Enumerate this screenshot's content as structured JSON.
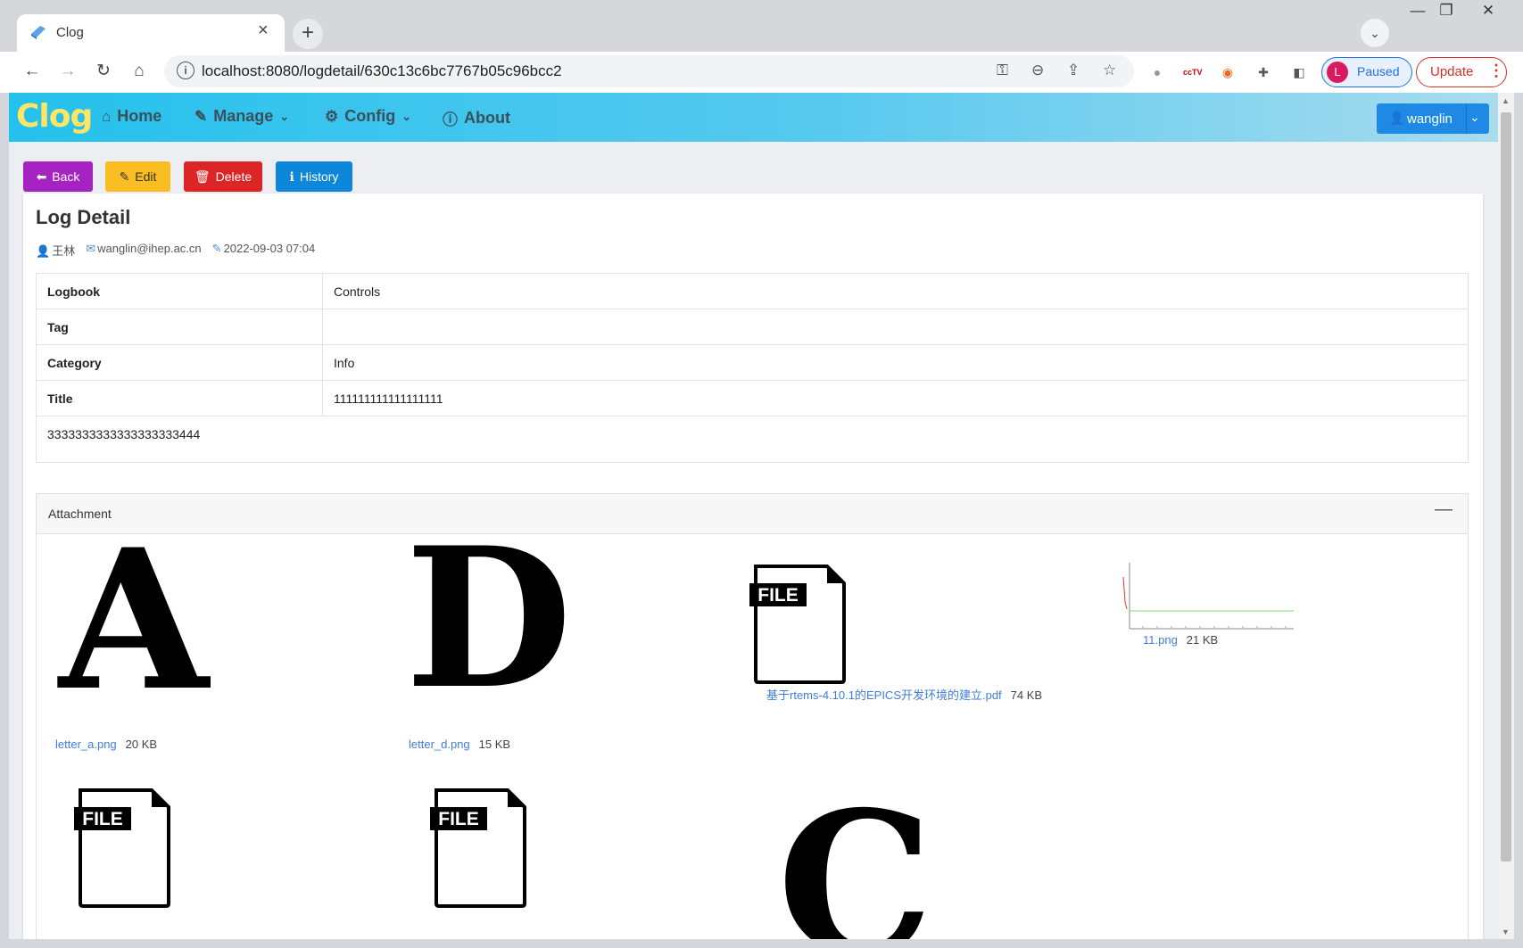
{
  "browser": {
    "tab_title": "Clog",
    "url": "localhost:8080/logdetail/630c13c6bc7767b05c96bcc2",
    "profile_initial": "L",
    "profile_label": "Paused",
    "update_label": "Update"
  },
  "app": {
    "brand": "Clog",
    "nav": {
      "home": "Home",
      "manage": "Manage",
      "config": "Config",
      "about": "About"
    },
    "user": "wanglin"
  },
  "actions": {
    "back": "Back",
    "edit": "Edit",
    "delete": "Delete",
    "history": "History"
  },
  "detail": {
    "title": "Log Detail",
    "author": "王林",
    "email": "wanglin@ihep.ac.cn",
    "date": "2022-09-03 07:04",
    "rows": [
      {
        "key": "Logbook",
        "value": "Controls"
      },
      {
        "key": "Tag",
        "value": ""
      },
      {
        "key": "Category",
        "value": "Info"
      },
      {
        "key": "Title",
        "value": "111111111111111111"
      }
    ],
    "body": "3333333333333333333444"
  },
  "attachments": {
    "header": "Attachment",
    "items": [
      {
        "name": "letter_a.png",
        "size": "20 KB",
        "preview": "A"
      },
      {
        "name": "letter_d.png",
        "size": "15 KB",
        "preview": "D"
      },
      {
        "name": "基于rtems-4.10.1的EPICS开发环境的建立.pdf",
        "size": "74 KB",
        "preview": "FILE"
      },
      {
        "name": "11.png",
        "size": "21 KB",
        "preview": "chart"
      },
      {
        "preview": "FILE"
      },
      {
        "preview": "FILE"
      },
      {
        "preview": "C"
      }
    ]
  },
  "colors": {
    "back": "#a523c1",
    "edit": "#fbbe22",
    "delete": "#dc2626",
    "history": "#0e86d9",
    "brand": "#ffe566",
    "link": "#3d7edb"
  }
}
